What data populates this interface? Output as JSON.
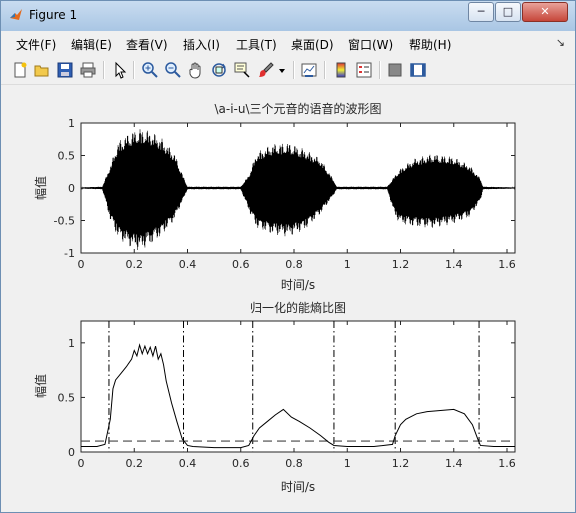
{
  "window": {
    "title": "Figure 1"
  },
  "window_controls": {
    "minimize": "─",
    "maximize": "□",
    "close": "✕"
  },
  "menu": {
    "items": [
      "文件(F)",
      "编辑(E)",
      "查看(V)",
      "插入(I)",
      "工具(T)",
      "桌面(D)",
      "窗口(W)",
      "帮助(H)"
    ],
    "overflow": "↘"
  },
  "toolbar_icons": [
    "new-figure-icon",
    "open-file-icon",
    "save-icon",
    "print-icon",
    "pointer-icon",
    "zoom-in-icon",
    "zoom-out-icon",
    "pan-hand-icon",
    "rotate-3d-icon",
    "data-cursor-icon",
    "brush-icon",
    "brush-dropdown-icon",
    "link-plot-icon",
    "colorbar-icon",
    "legend-icon",
    "hide-plot-tools-icon",
    "show-plot-tools-icon"
  ],
  "colors": {
    "background": "#f0f0f0",
    "axes": "#ffffff",
    "line": "#000000",
    "threshold": "#444444"
  },
  "chart_data": [
    {
      "type": "line",
      "title": "\\a-i-u\\三个元音的语音的波形图",
      "xlabel": "时间/s",
      "ylabel": "幅值",
      "xlim": [
        0,
        1.63
      ],
      "ylim": [
        -1,
        1
      ],
      "xticks": [
        "0",
        "0.2",
        "0.4",
        "0.6",
        "0.8",
        "1",
        "1.2",
        "1.4",
        "1.6"
      ],
      "yticks": [
        "-1",
        "-0.5",
        "0",
        "0.5",
        "1"
      ],
      "series": [
        {
          "envelope": {
            "t": [
              0,
              0.08,
              0.11,
              0.14,
              0.18,
              0.22,
              0.26,
              0.3,
              0.35,
              0.39,
              0.4,
              0.6,
              0.63,
              0.66,
              0.72,
              0.78,
              0.84,
              0.9,
              0.95,
              0.96,
              1.15,
              1.18,
              1.2,
              1.25,
              1.32,
              1.4,
              1.46,
              1.5,
              1.51,
              1.63
            ],
            "upper": [
              0.01,
              0.02,
              0.35,
              0.72,
              0.85,
              0.92,
              0.88,
              0.78,
              0.55,
              0.12,
              0.02,
              0.02,
              0.2,
              0.55,
              0.68,
              0.7,
              0.6,
              0.45,
              0.12,
              0.02,
              0.02,
              0.2,
              0.3,
              0.45,
              0.53,
              0.48,
              0.35,
              0.15,
              0.02,
              0.01
            ],
            "lower": [
              -0.01,
              -0.02,
              -0.5,
              -0.78,
              -0.9,
              -0.97,
              -0.88,
              -0.75,
              -0.5,
              -0.12,
              -0.02,
              -0.02,
              -0.35,
              -0.62,
              -0.72,
              -0.75,
              -0.65,
              -0.4,
              -0.1,
              -0.02,
              -0.02,
              -0.45,
              -0.55,
              -0.6,
              -0.62,
              -0.55,
              -0.45,
              -0.2,
              -0.02,
              -0.01
            ]
          }
        }
      ]
    },
    {
      "type": "line",
      "title": "归一化的能熵比图",
      "xlabel": "时间/s",
      "ylabel": "幅值",
      "xlim": [
        0,
        1.63
      ],
      "ylim": [
        0,
        1.2
      ],
      "xticks": [
        "0",
        "0.2",
        "0.4",
        "0.6",
        "0.8",
        "1",
        "1.2",
        "1.4",
        "1.6"
      ],
      "yticks": [
        "0",
        "0.5",
        "1"
      ],
      "series": [
        {
          "x": [
            0,
            0.06,
            0.09,
            0.11,
            0.12,
            0.13,
            0.15,
            0.17,
            0.19,
            0.2,
            0.21,
            0.22,
            0.23,
            0.24,
            0.25,
            0.26,
            0.27,
            0.28,
            0.29,
            0.3,
            0.31,
            0.32,
            0.34,
            0.36,
            0.38,
            0.4,
            0.42,
            0.5,
            0.6,
            0.63,
            0.65,
            0.67,
            0.7,
            0.73,
            0.76,
            0.79,
            0.82,
            0.86,
            0.9,
            0.93,
            0.95,
            1.0,
            1.1,
            1.17,
            1.18,
            1.2,
            1.22,
            1.26,
            1.3,
            1.35,
            1.4,
            1.44,
            1.47,
            1.49,
            1.5,
            1.55,
            1.63
          ],
          "y": [
            0.05,
            0.05,
            0.07,
            0.3,
            0.58,
            0.66,
            0.72,
            0.78,
            0.85,
            0.93,
            0.88,
            0.98,
            0.9,
            0.97,
            0.9,
            0.96,
            0.88,
            0.97,
            0.85,
            0.9,
            0.8,
            0.65,
            0.45,
            0.28,
            0.12,
            0.06,
            0.05,
            0.04,
            0.04,
            0.06,
            0.15,
            0.22,
            0.28,
            0.34,
            0.39,
            0.32,
            0.28,
            0.22,
            0.15,
            0.09,
            0.06,
            0.05,
            0.05,
            0.07,
            0.15,
            0.25,
            0.3,
            0.35,
            0.37,
            0.38,
            0.39,
            0.35,
            0.25,
            0.12,
            0.06,
            0.05,
            0.05
          ]
        }
      ],
      "threshold": 0.1,
      "boundaries": [
        0.105,
        0.385,
        0.645,
        0.95,
        1.18,
        1.495
      ]
    }
  ]
}
